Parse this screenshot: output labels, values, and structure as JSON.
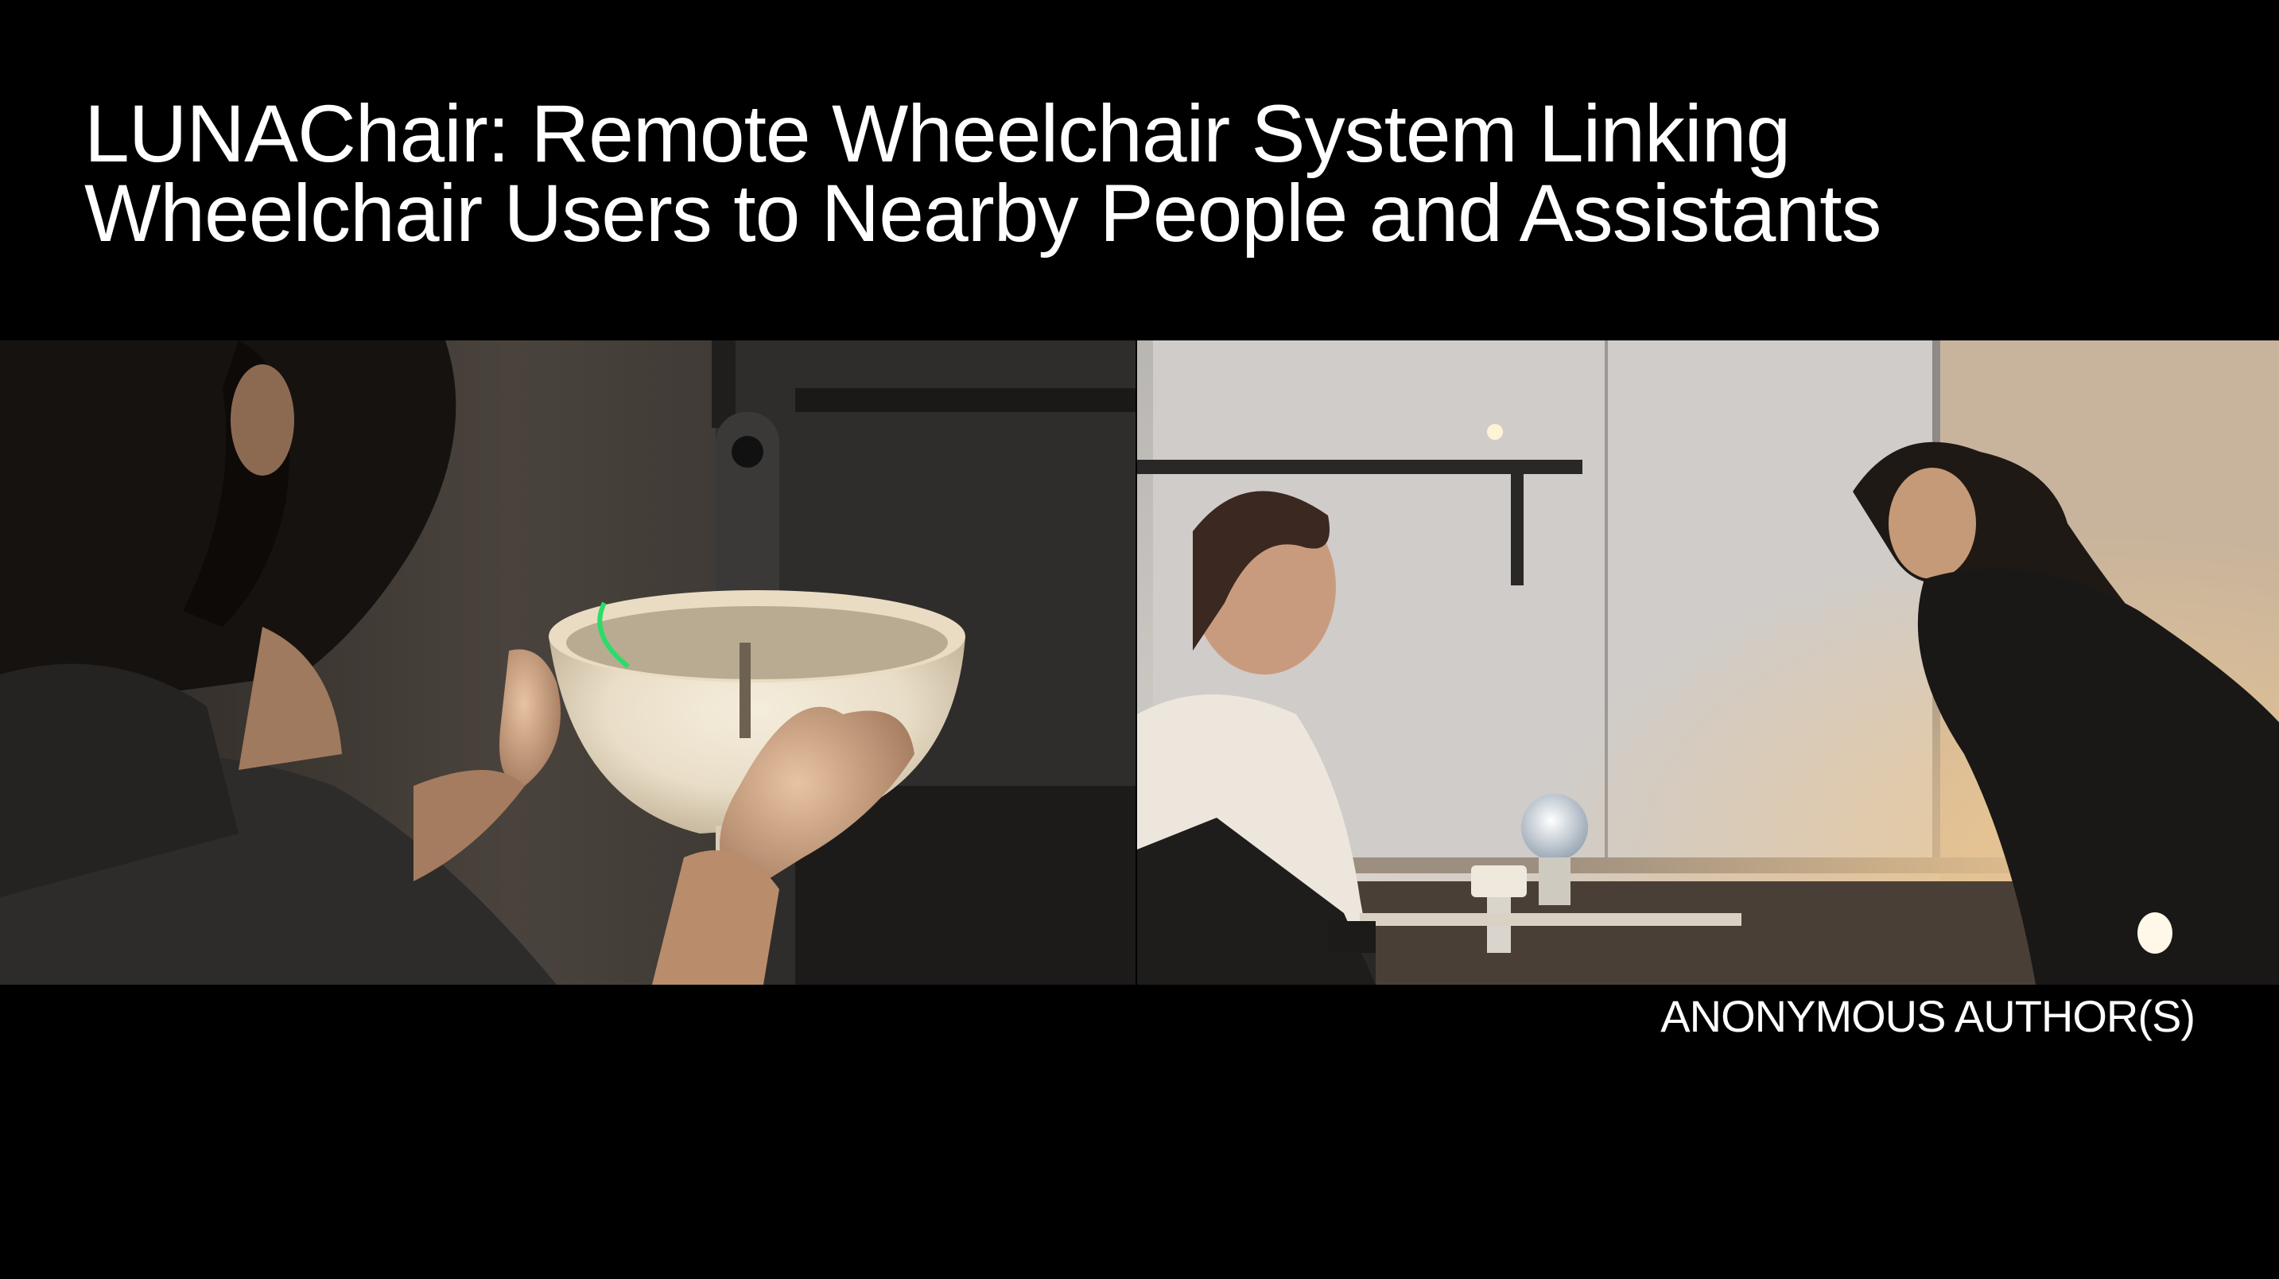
{
  "title": {
    "line1": "LUNAChair: Remote Wheelchair System Linking",
    "line2": "Wheelchair Users to Nearby People and Assistants"
  },
  "credit": "ANONYMOUS AUTHOR(S)",
  "colors": {
    "background": "#000000",
    "text": "#ffffff"
  }
}
